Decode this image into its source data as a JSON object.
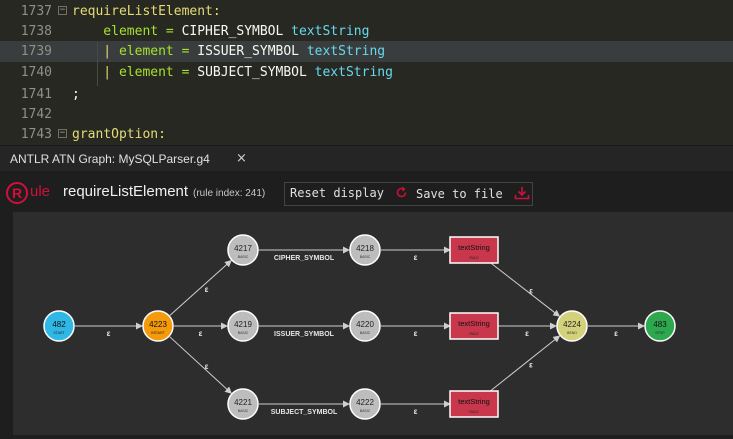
{
  "editor": {
    "lines": [
      {
        "num": "1737",
        "fold": "−",
        "parts": [
          {
            "t": "requireListElement:",
            "c": "kw-y"
          }
        ]
      },
      {
        "num": "1738",
        "parts": [
          {
            "t": "    element = ",
            "c": "kw-g"
          },
          {
            "t": "CIPHER_SYMBOL ",
            "c": ""
          },
          {
            "t": "textString",
            "c": "kw-c"
          }
        ]
      },
      {
        "num": "1739",
        "parts": [
          {
            "t": "    | ",
            "c": "kw-y"
          },
          {
            "t": "element = ",
            "c": "kw-g"
          },
          {
            "t": "ISSUER_SYMBOL ",
            "c": ""
          },
          {
            "t": "textString",
            "c": "kw-c"
          }
        ],
        "highlight": true
      },
      {
        "num": "1740",
        "parts": [
          {
            "t": "    | ",
            "c": "kw-y"
          },
          {
            "t": "element = ",
            "c": "kw-g"
          },
          {
            "t": "SUBJECT_SYMBOL ",
            "c": ""
          },
          {
            "t": "textString",
            "c": "kw-c"
          }
        ]
      },
      {
        "num": "1741",
        "parts": [
          {
            "t": ";",
            "c": ""
          }
        ]
      },
      {
        "num": "1742",
        "parts": []
      },
      {
        "num": "1743",
        "fold": "−",
        "parts": [
          {
            "t": "grantOption:",
            "c": "kw-y"
          }
        ]
      }
    ]
  },
  "tab": {
    "title": "ANTLR ATN Graph: MySQLParser.g4",
    "close": "×"
  },
  "header": {
    "logo_letter": "R",
    "logo_word": "ule",
    "rule_name": "requireListElement",
    "rule_index": "(rule index: 241)",
    "reset_label": "Reset display",
    "save_label": "Save to file",
    "reset_icon": "refresh-icon",
    "save_icon": "download-icon"
  },
  "graph": {
    "nodes": [
      {
        "id": "n482",
        "num": "482",
        "sub": "START",
        "shape": "circle",
        "color": "#2fb7e6"
      },
      {
        "id": "n4223",
        "num": "4223",
        "sub": "BSTART",
        "shape": "circle",
        "color": "#f59a0b"
      },
      {
        "id": "n4217",
        "num": "4217",
        "sub": "BASIC",
        "shape": "circle",
        "color": "#bdbdbd"
      },
      {
        "id": "n4219",
        "num": "4219",
        "sub": "BASIC",
        "shape": "circle",
        "color": "#bdbdbd"
      },
      {
        "id": "n4221",
        "num": "4221",
        "sub": "BASIC",
        "shape": "circle",
        "color": "#bdbdbd"
      },
      {
        "id": "n4218",
        "num": "4218",
        "sub": "BASIC",
        "shape": "circle",
        "color": "#bdbdbd"
      },
      {
        "id": "n4220",
        "num": "4220",
        "sub": "BASIC",
        "shape": "circle",
        "color": "#bdbdbd"
      },
      {
        "id": "n4222",
        "num": "4222",
        "sub": "BASIC",
        "shape": "circle",
        "color": "#bdbdbd"
      },
      {
        "id": "r1",
        "num": "textString",
        "sub": "RULE",
        "shape": "rect",
        "color": "#c8374b"
      },
      {
        "id": "r2",
        "num": "textString",
        "sub": "RULE",
        "shape": "rect",
        "color": "#c8374b"
      },
      {
        "id": "r3",
        "num": "textString",
        "sub": "RULE",
        "shape": "rect",
        "color": "#c8374b"
      },
      {
        "id": "n4224",
        "num": "4224",
        "sub": "BEND",
        "shape": "circle",
        "color": "#d3d27a"
      },
      {
        "id": "n483",
        "num": "483",
        "sub": "STOP",
        "shape": "circle",
        "color": "#2ea84f"
      }
    ],
    "edges": [
      {
        "from": "n482",
        "to": "n4223",
        "label": "ε"
      },
      {
        "from": "n4223",
        "to": "n4217",
        "label": "ε"
      },
      {
        "from": "n4223",
        "to": "n4219",
        "label": "ε"
      },
      {
        "from": "n4223",
        "to": "n4221",
        "label": "ε"
      },
      {
        "from": "n4217",
        "to": "n4218",
        "label": "CIPHER_SYMBOL"
      },
      {
        "from": "n4219",
        "to": "n4220",
        "label": "ISSUER_SYMBOL"
      },
      {
        "from": "n4221",
        "to": "n4222",
        "label": "SUBJECT_SYMBOL"
      },
      {
        "from": "n4218",
        "to": "r1",
        "label": "ε"
      },
      {
        "from": "n4220",
        "to": "r2",
        "label": "ε"
      },
      {
        "from": "n4222",
        "to": "r3",
        "label": "ε"
      },
      {
        "from": "r1",
        "to": "n4224",
        "label": "ε"
      },
      {
        "from": "r2",
        "to": "n4224",
        "label": "ε"
      },
      {
        "from": "r3",
        "to": "n4224",
        "label": "ε"
      },
      {
        "from": "n4224",
        "to": "n483",
        "label": "ε"
      }
    ]
  }
}
